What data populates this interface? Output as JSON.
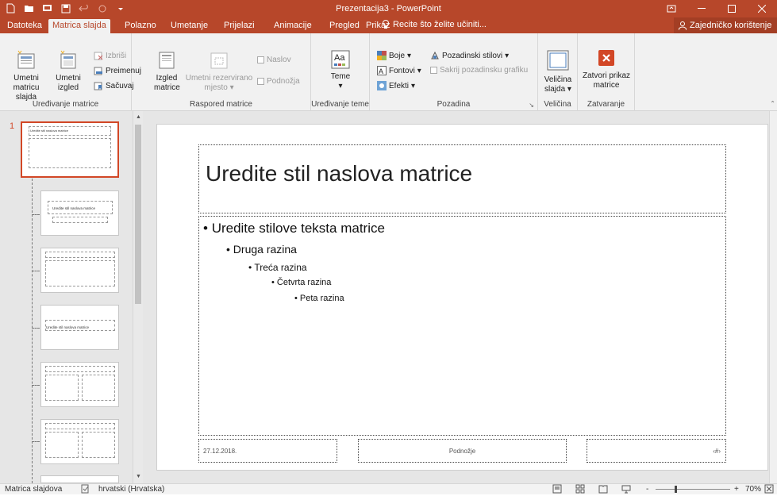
{
  "window": {
    "title": "Prezentacija3 - PowerPoint"
  },
  "colors": {
    "accent": "#b7472a",
    "selected_thumb": "#d24726",
    "ribbon_bg": "#f1f1f1",
    "workspace": "#e6e6e6"
  },
  "tabs": [
    {
      "label": "Datoteka",
      "active": false
    },
    {
      "label": "Matrica slajda",
      "active": true
    },
    {
      "label": "Polazno",
      "active": false
    },
    {
      "label": "Umetanje",
      "active": false
    },
    {
      "label": "Prijelazi",
      "active": false
    },
    {
      "label": "Animacije",
      "active": false
    },
    {
      "label": "Pregled",
      "active": false
    },
    {
      "label": "Prikaz",
      "active": false
    }
  ],
  "tellme": {
    "text": "Recite što želite učiniti..."
  },
  "share": {
    "label": "Zajedničko korištenje"
  },
  "ribbon": {
    "edit_master": {
      "label": "Uređivanje matrice",
      "insert_master": [
        "Umetni",
        "matricu slajda"
      ],
      "insert_layout": [
        "Umetni",
        "izgled"
      ],
      "delete": "Izbriši",
      "rename": "Preimenuj",
      "preserve": "Sačuvaj"
    },
    "master_layout": {
      "label": "Raspored matrice",
      "layout_master": [
        "Izgled",
        "matrice"
      ],
      "insert_placeholder": [
        "Umetni rezervirano",
        "mjesto"
      ],
      "title_cb": "Naslov",
      "footers_cb": "Podnožja"
    },
    "edit_theme": {
      "label": "Uređivanje teme",
      "themes": "Teme"
    },
    "background": {
      "label": "Pozadina",
      "colors": "Boje",
      "fonts": "Fontovi",
      "effects": "Efekti",
      "bg_styles": "Pozadinski stilovi",
      "hide_bg": "Sakrij pozadinsku grafiku"
    },
    "size": {
      "label": "Veličina",
      "slide_size": [
        "Veličina",
        "slajda"
      ]
    },
    "close": {
      "label": "Zatvaranje",
      "close_view": [
        "Zatvori prikaz",
        "matrice"
      ]
    }
  },
  "thumbnails": {
    "number": "1",
    "master_title": "Uredite stil naslova matrice"
  },
  "slide": {
    "title": "Uredite stil naslova matrice",
    "bullets": [
      "Uredite stilove teksta matrice",
      "Druga razina",
      "Treća razina",
      "Četvrta razina",
      "Peta razina"
    ],
    "footer_date": "27.12.2018.",
    "footer_text": "Podnožje",
    "footer_num": "‹#›"
  },
  "status": {
    "view": "Matrica slajdova",
    "language": "hrvatski (Hrvatska)",
    "zoom": "70%",
    "zoom_minus": "-",
    "zoom_plus": "+"
  }
}
